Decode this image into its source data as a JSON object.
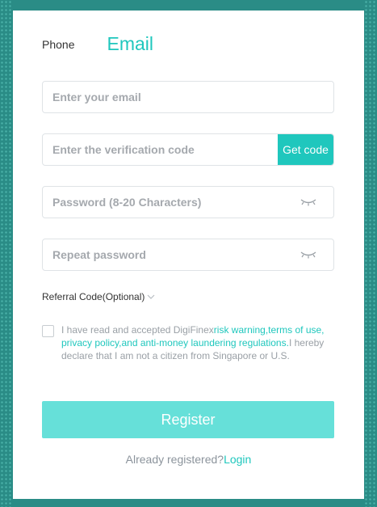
{
  "tabs": {
    "phone_label": "Phone",
    "email_label": "Email",
    "active": "Email"
  },
  "form": {
    "email_placeholder": "Enter your email",
    "code_placeholder": "Enter the verification code",
    "get_code_label": "Get code",
    "password_placeholder": "Password (8-20 Characters)",
    "repeat_placeholder": "Repeat password",
    "eye_icon": "eye-closed-icon",
    "referral_label": "Referral Code(Optional)",
    "referral_icon": "chevron-down-icon"
  },
  "agreement": {
    "checked": false,
    "prefix": "I have read and accepted DigiFinex",
    "link_risk": "risk warning,",
    "link_terms": "terms of use,",
    "link_privacy": "privacy policy,",
    "link_aml": "and anti-money laundering regulations.",
    "suffix": "I hereby declare that I am not a citizen from Singapore or U.S."
  },
  "register_label": "Register",
  "login": {
    "prompt": "Already registered?",
    "link": "Login"
  },
  "colors": {
    "accent": "#1fc7bd",
    "register_bg": "#66e0d9",
    "page_bg": "#2a8c86"
  }
}
